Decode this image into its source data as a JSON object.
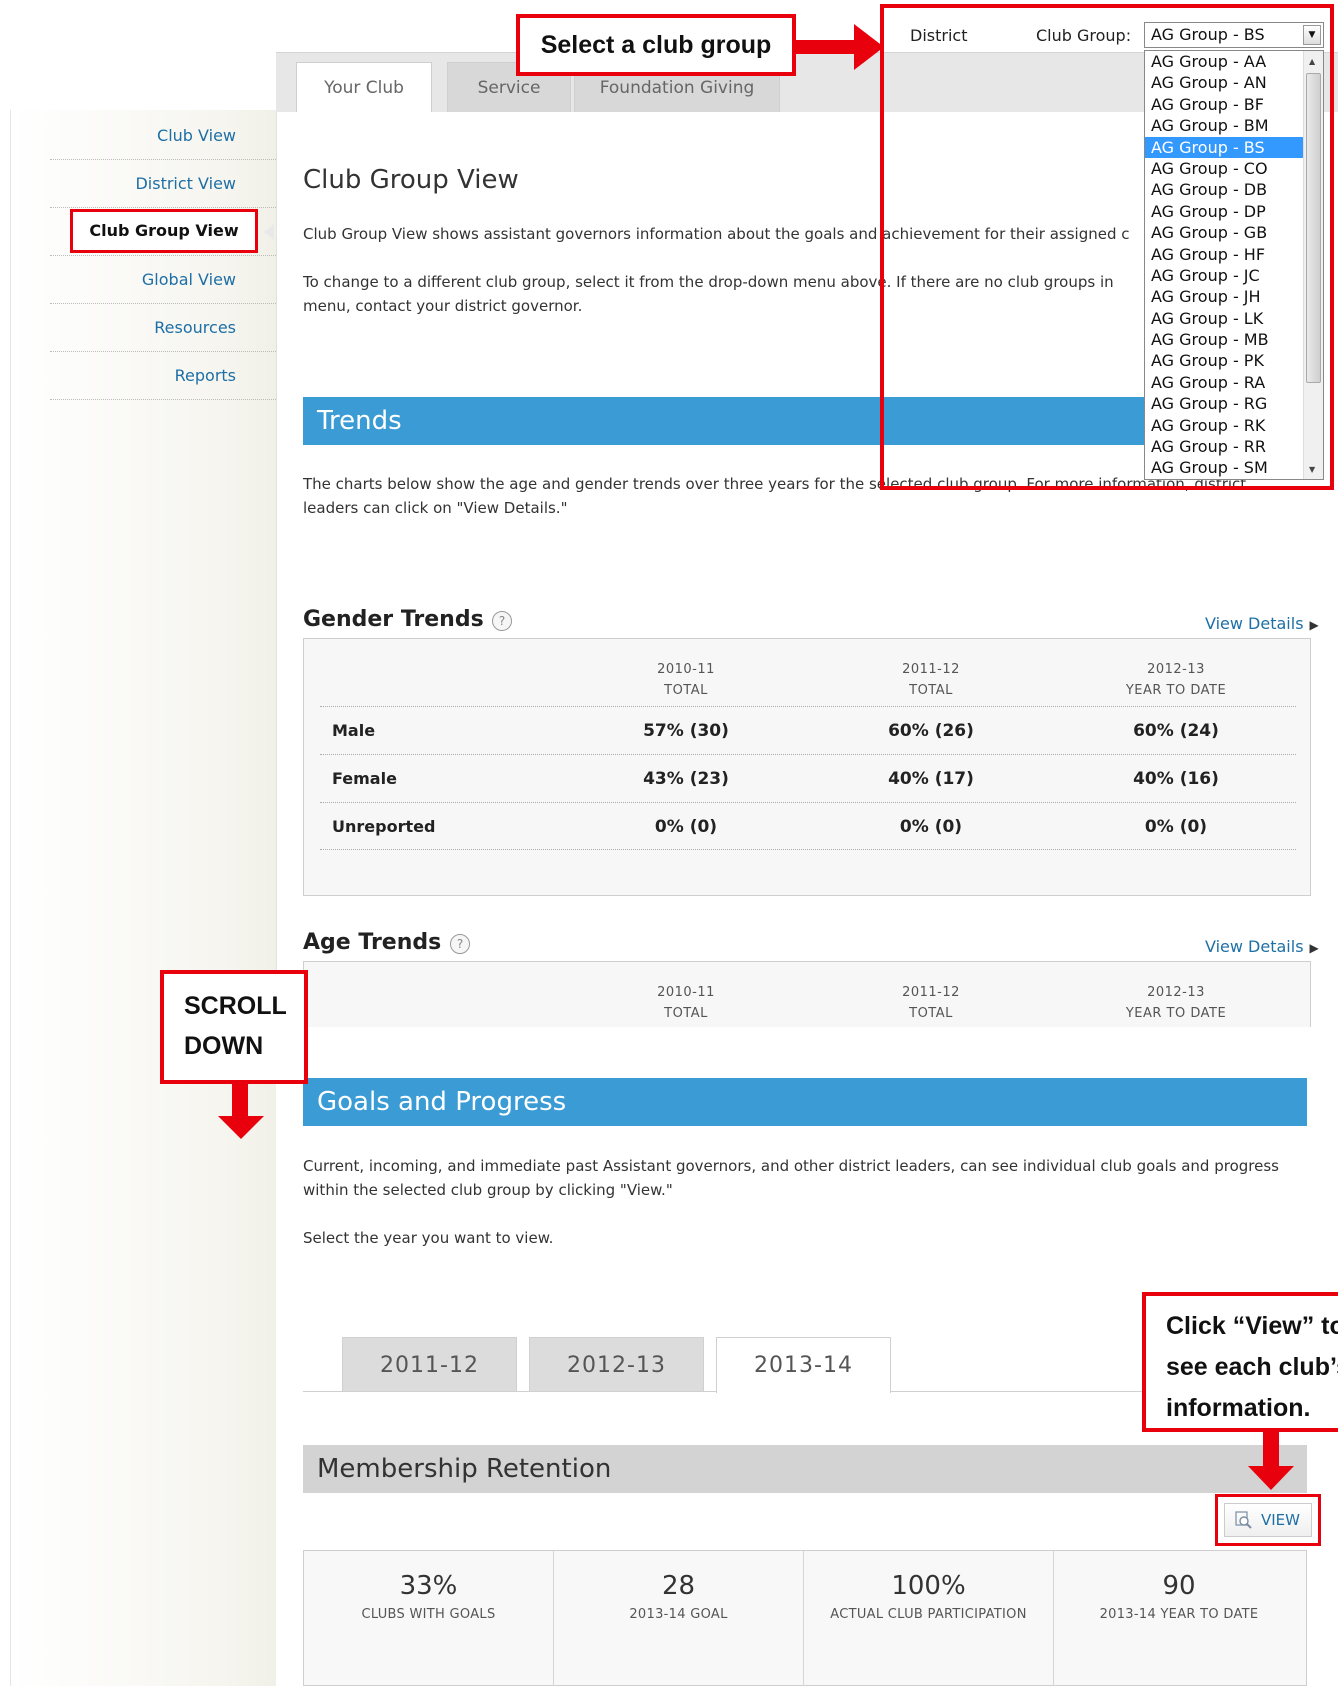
{
  "header": {
    "district_label": "District",
    "club_group_label": "Club Group:",
    "selected_group": "AG Group - BS",
    "dropdown_options": [
      "AG Group - AA",
      "AG Group - AN",
      "AG Group - BF",
      "AG Group - BM",
      "AG Group - BS",
      "AG Group - CO",
      "AG Group - DB",
      "AG Group - DP",
      "AG Group - GB",
      "AG Group - HF",
      "AG Group - JC",
      "AG Group - JH",
      "AG Group - LK",
      "AG Group - MB",
      "AG Group - PK",
      "AG Group - RA",
      "AG Group - RG",
      "AG Group - RK",
      "AG Group - RR",
      "AG Group - SM"
    ]
  },
  "tabs": [
    {
      "label": "Your Club",
      "active": true
    },
    {
      "label": "Service",
      "active": false
    },
    {
      "label": "Foundation Giving",
      "active": false
    }
  ],
  "sidebar": {
    "items": [
      {
        "label": "Club View"
      },
      {
        "label": "District View"
      },
      {
        "label": "Club Group View",
        "active": true
      },
      {
        "label": "Global View"
      },
      {
        "label": "Resources"
      },
      {
        "label": "Reports"
      }
    ]
  },
  "main": {
    "title": "Club Group View",
    "intro": "Club Group View shows assistant governors information about the goals and achievement for their assigned c",
    "change_line1": "To change to a different club group, select it from the drop-down menu above. If there are no club groups in",
    "change_line2": "menu, contact your district governor.",
    "trends_banner": "Trends",
    "trends_line1": "The charts below show the age and gender trends over three years for the selected club group. For more information, district",
    "trends_line2": "leaders can click on \"View Details.\""
  },
  "gender_trends": {
    "title": "Gender Trends",
    "help": "?",
    "view_details": "View Details",
    "columns": [
      {
        "year": "2010-11",
        "sub": "TOTAL"
      },
      {
        "year": "2011-12",
        "sub": "TOTAL"
      },
      {
        "year": "2012-13",
        "sub": "YEAR TO DATE"
      }
    ],
    "rows": [
      {
        "label": "Male",
        "values": [
          "57% (30)",
          "60% (26)",
          "60% (24)"
        ]
      },
      {
        "label": "Female",
        "values": [
          "43% (23)",
          "40% (17)",
          "40% (16)"
        ]
      },
      {
        "label": "Unreported",
        "values": [
          "0% (0)",
          "0% (0)",
          "0% (0)"
        ]
      }
    ]
  },
  "age_trends": {
    "title": "Age Trends",
    "help": "?",
    "view_details": "View Details",
    "columns": [
      {
        "year": "2010-11",
        "sub": "TOTAL"
      },
      {
        "year": "2011-12",
        "sub": "TOTAL"
      },
      {
        "year": "2012-13",
        "sub": "YEAR TO DATE"
      }
    ]
  },
  "goals": {
    "banner": "Goals and Progress",
    "line1": "Current, incoming, and immediate past Assistant governors, and other district leaders, can see individual club goals and progress",
    "line2": "within the selected club group by clicking \"View.\"",
    "select_year": "Select the year you want to view.",
    "year_tabs": [
      {
        "label": "2011-12",
        "active": false
      },
      {
        "label": "2012-13",
        "active": false
      },
      {
        "label": "2013-14",
        "active": true
      }
    ],
    "retention_title": "Membership Retention",
    "view_button": "VIEW",
    "stats": [
      {
        "value": "33%",
        "label": "CLUBS WITH GOALS"
      },
      {
        "value": "28",
        "label": "2013-14 GOAL"
      },
      {
        "value": "100%",
        "label": "ACTUAL CLUB PARTICIPATION"
      },
      {
        "value": "90",
        "label": "2013-14 YEAR TO DATE"
      }
    ]
  },
  "annotations": {
    "select_group": "Select a club group",
    "scroll_line1": "SCROLL",
    "scroll_line2": "DOWN",
    "click_line1": "Click “View” to",
    "click_line2": "see each club’s",
    "click_line3": "information."
  },
  "colors": {
    "accent": "#3a9bd5",
    "annotation": "#e8000d",
    "link": "#1d6fa5"
  }
}
